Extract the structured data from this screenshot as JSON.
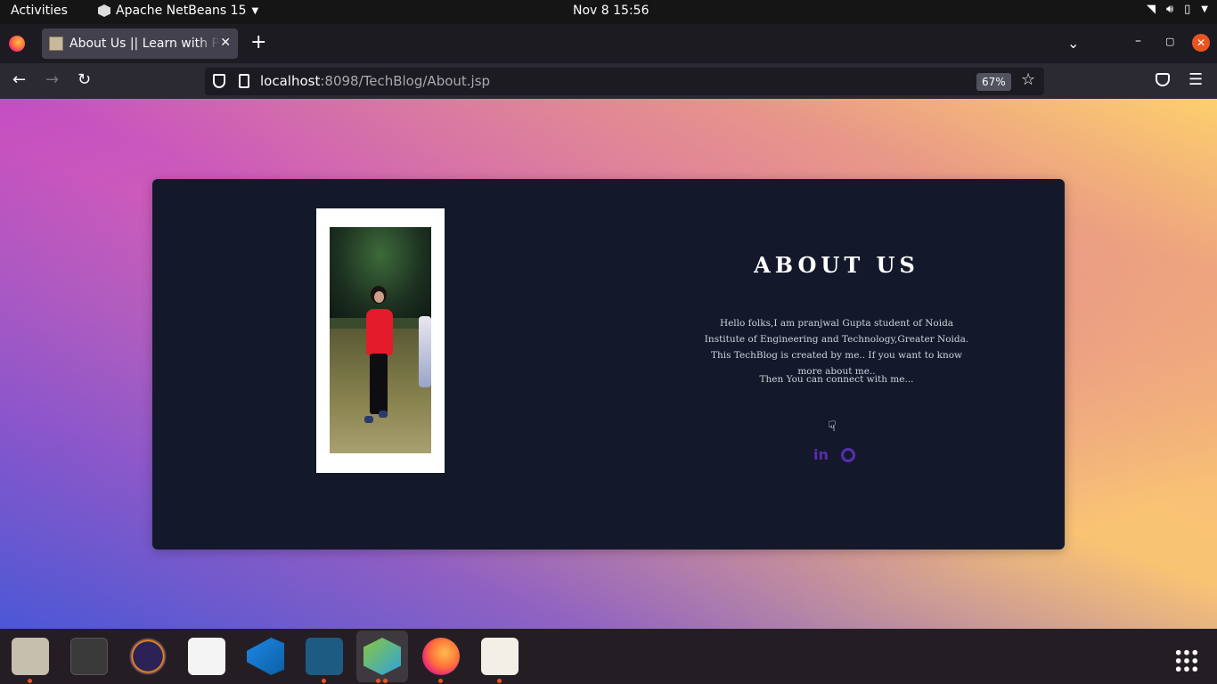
{
  "topbar": {
    "activities": "Activities",
    "app_name": "Apache NetBeans 15",
    "clock": "Nov 8  15:56"
  },
  "browser": {
    "tab_title": "About Us || Learn with Programmer",
    "url_host": "localhost",
    "url_rest": ":8098/TechBlog/About.jsp",
    "zoom": "67%"
  },
  "about": {
    "heading": "ABOUT US",
    "paragraph": "Hello folks,I am pranjwal Gupta student of Noida Institute of Engineering and Technology,Greater Noida. This TechBlog is created by me.. If you want to know more about me..",
    "connect": "Then You can connect with me...",
    "linkedin_label": "in"
  },
  "colors": {
    "card_bg": "#13192b",
    "social_icon": "#5a2db0",
    "accent": "#e95420"
  },
  "dock": {
    "items": [
      "files-icon",
      "terminal-icon",
      "eclipse-icon",
      "text-editor-icon",
      "vscode-icon",
      "mysql-workbench-icon",
      "netbeans-icon",
      "firefox-icon",
      "document-viewer-icon"
    ]
  }
}
